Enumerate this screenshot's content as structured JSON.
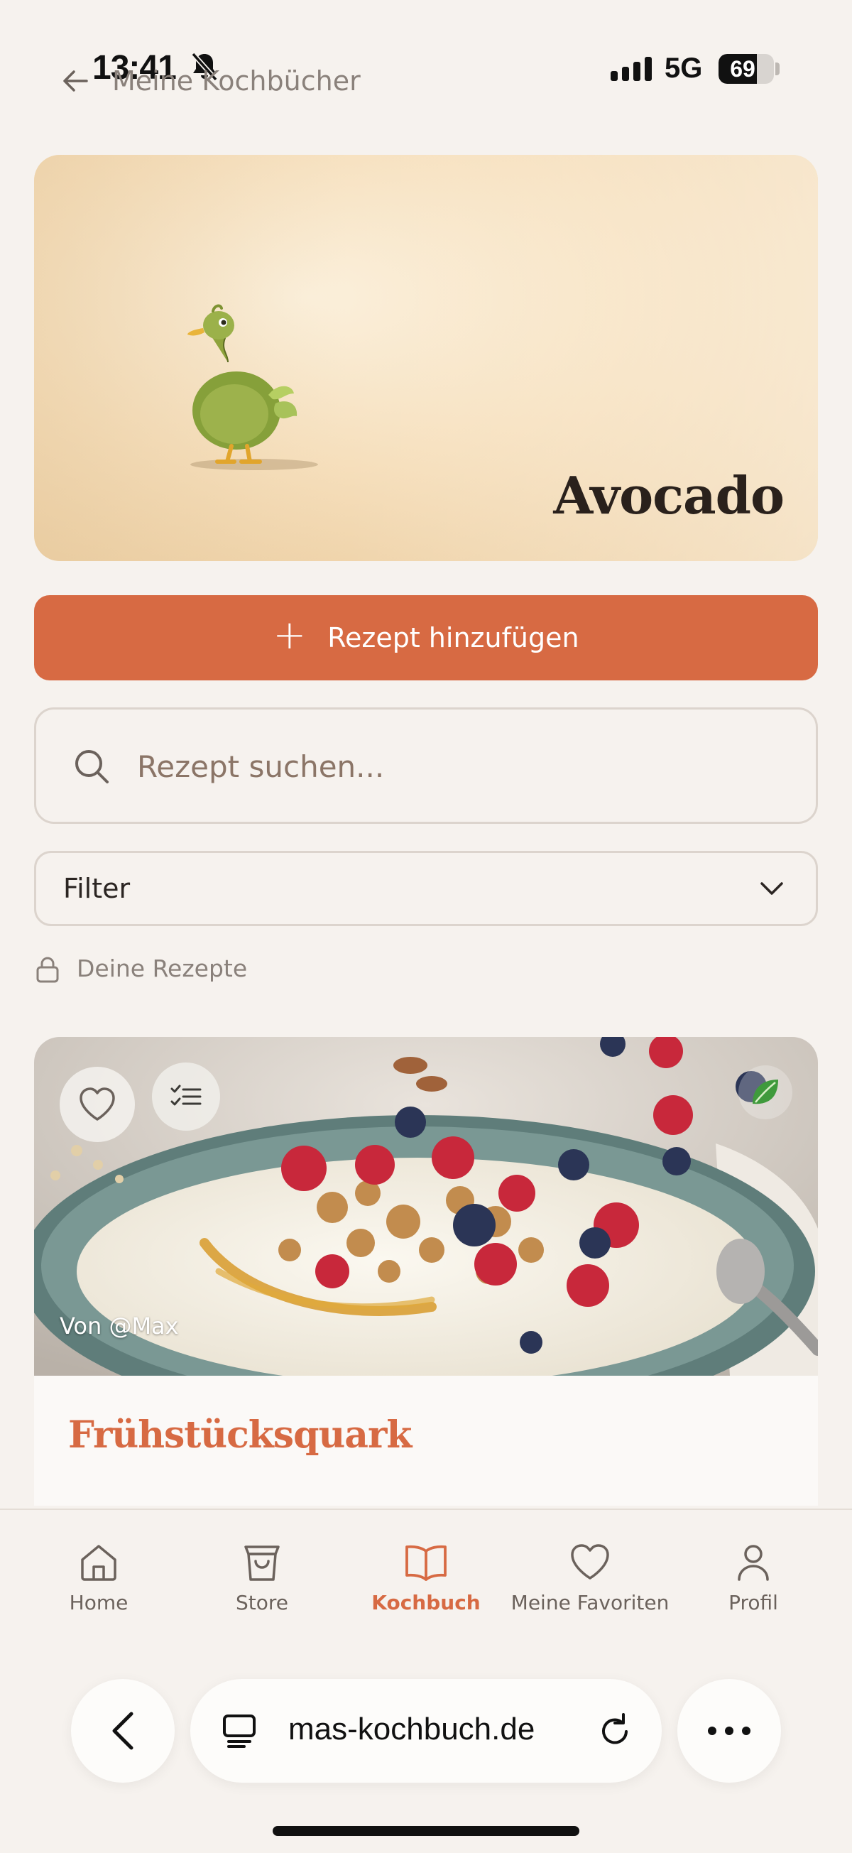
{
  "status_bar": {
    "time": "13:41",
    "network": "5G",
    "battery": "69",
    "battery_level": 0.69
  },
  "header": {
    "back_label": "Meine Kochbücher"
  },
  "cookbook": {
    "title": "Avocado"
  },
  "actions": {
    "add_recipe_label": "Rezept hinzufügen"
  },
  "search": {
    "placeholder": "Rezept suchen..."
  },
  "filter": {
    "label": "Filter"
  },
  "privacy": {
    "label": "Deine Rezepte"
  },
  "recipe_card": {
    "author": "Von @Max",
    "title": "Frühstücksquark"
  },
  "bottom_nav": {
    "items": [
      {
        "label": "Home",
        "icon": "home-icon",
        "active": false
      },
      {
        "label": "Store",
        "icon": "shopping-bag-icon",
        "active": false
      },
      {
        "label": "Kochbuch",
        "icon": "book-icon",
        "active": true
      },
      {
        "label": "Meine Favoriten",
        "icon": "heart-icon",
        "active": false
      },
      {
        "label": "Profil",
        "icon": "user-icon",
        "active": false
      }
    ]
  },
  "browser": {
    "url": "mas-kochbuch.de"
  },
  "colors": {
    "accent": "#d76a43",
    "background": "#f6f2ee",
    "text": "#2b2522",
    "muted": "#8a817b"
  }
}
